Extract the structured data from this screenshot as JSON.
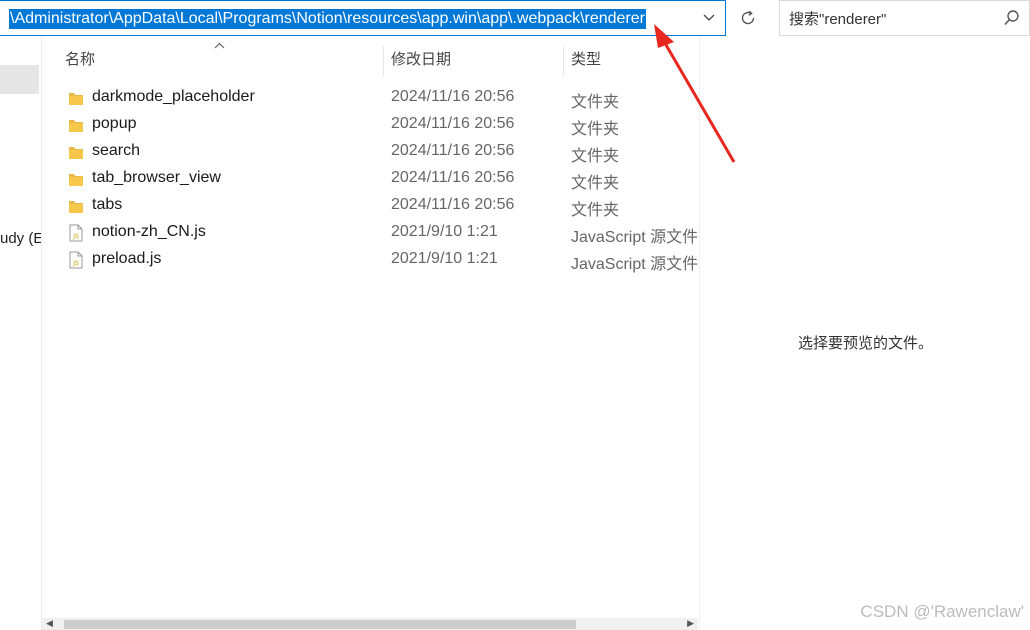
{
  "address_bar": {
    "path": "\\Administrator\\AppData\\Local\\Programs\\Notion\\resources\\app.win\\app\\.webpack\\renderer",
    "dropdown_icon": "chevron-down-icon",
    "refresh_icon": "refresh-icon"
  },
  "search": {
    "placeholder": "搜索\"renderer\"",
    "icon": "search-icon"
  },
  "nav_pane": {
    "partial_label": "udy (E",
    "partial_label2": ")"
  },
  "columns": {
    "name": "名称",
    "date": "修改日期",
    "type": "类型"
  },
  "files": [
    {
      "name": "darkmode_placeholder",
      "date": "2024/11/16 20:56",
      "type": "文件夹",
      "icon": "folder-icon"
    },
    {
      "name": "popup",
      "date": "2024/11/16 20:56",
      "type": "文件夹",
      "icon": "folder-icon"
    },
    {
      "name": "search",
      "date": "2024/11/16 20:56",
      "type": "文件夹",
      "icon": "folder-icon"
    },
    {
      "name": "tab_browser_view",
      "date": "2024/11/16 20:56",
      "type": "文件夹",
      "icon": "folder-icon"
    },
    {
      "name": "tabs",
      "date": "2024/11/16 20:56",
      "type": "文件夹",
      "icon": "folder-icon"
    },
    {
      "name": "notion-zh_CN.js",
      "date": "2021/9/10 1:21",
      "type": "JavaScript 源文件",
      "icon": "js-file-icon"
    },
    {
      "name": "preload.js",
      "date": "2021/9/10 1:21",
      "type": "JavaScript 源文件",
      "icon": "js-file-icon"
    }
  ],
  "preview": {
    "message": "选择要预览的文件。"
  },
  "watermark": "CSDN @'Rawenclaw'",
  "colors": {
    "selection": "#0078d7",
    "folder": "#e8b84a",
    "annotation_arrow": "#e8271e"
  }
}
